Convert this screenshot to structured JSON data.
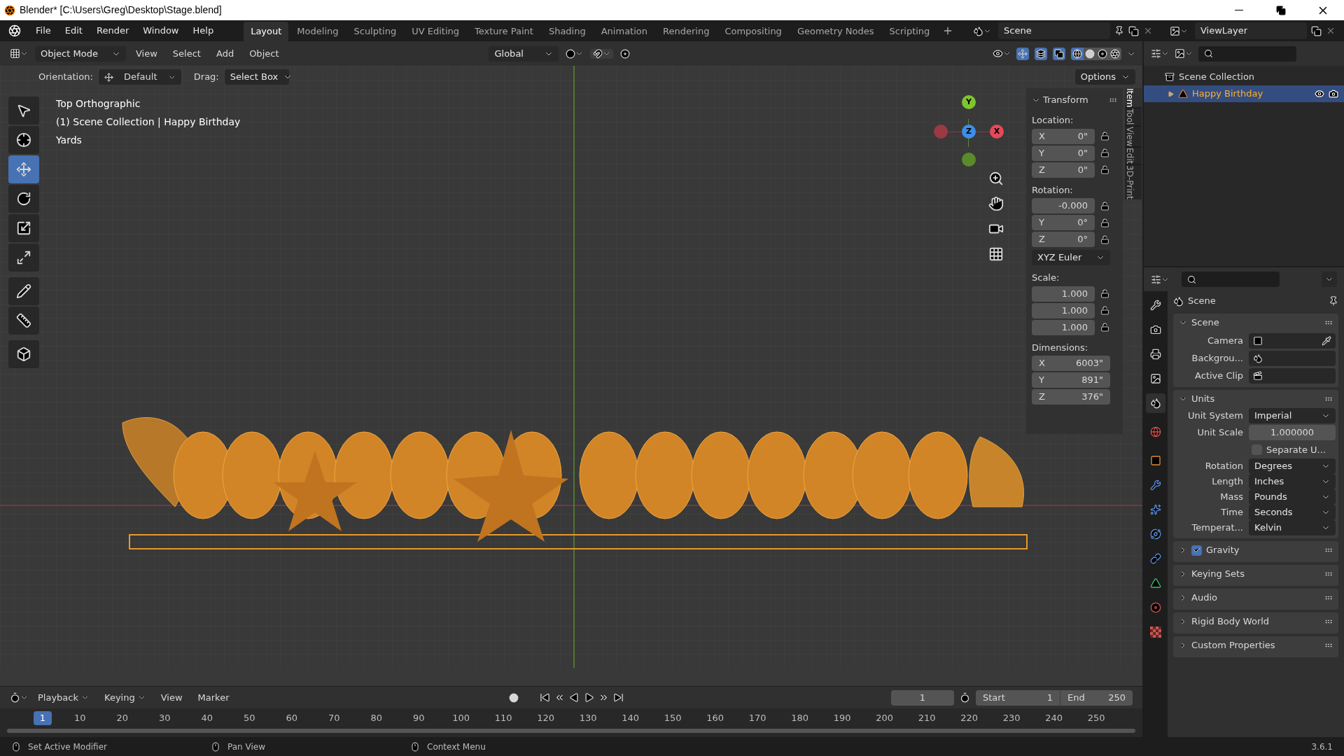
{
  "window": {
    "title": "Blender* [C:\\Users\\Greg\\Desktop\\Stage.blend]"
  },
  "menu": [
    "File",
    "Edit",
    "Render",
    "Window",
    "Help"
  ],
  "workspaces": [
    {
      "label": "Layout",
      "selected": true
    },
    {
      "label": "Modeling",
      "selected": false
    },
    {
      "label": "Sculpting",
      "selected": false
    },
    {
      "label": "UV Editing",
      "selected": false
    },
    {
      "label": "Texture Paint",
      "selected": false
    },
    {
      "label": "Shading",
      "selected": false
    },
    {
      "label": "Animation",
      "selected": false
    },
    {
      "label": "Rendering",
      "selected": false
    },
    {
      "label": "Compositing",
      "selected": false
    },
    {
      "label": "Geometry Nodes",
      "selected": false
    },
    {
      "label": "Scripting",
      "selected": false
    }
  ],
  "scene_selector": {
    "value": "Scene"
  },
  "view_layer": {
    "value": "ViewLayer"
  },
  "viewport_header": {
    "mode": "Object Mode",
    "menus": [
      "View",
      "Select",
      "Add",
      "Object"
    ],
    "transform_orientation": "Global"
  },
  "tool_settings": {
    "orientation_label": "Orientation:",
    "orientation": "Default",
    "drag_label": "Drag:",
    "drag": "Select Box",
    "options": "Options"
  },
  "toolbar": [
    {
      "kind": "select",
      "selected": false
    },
    {
      "kind": "cursor",
      "selected": false
    },
    {
      "kind": "move",
      "selected": true
    },
    {
      "kind": "rotate",
      "selected": false
    },
    {
      "kind": "scale",
      "selected": false
    },
    {
      "kind": "transform",
      "selected": false
    },
    {
      "kind": "annotate",
      "selected": false
    },
    {
      "kind": "measure",
      "selected": false
    },
    {
      "kind": "add-cube",
      "selected": false
    }
  ],
  "viewport_info": [
    "Top Orthographic",
    "(1) Scene Collection | Happy Birthday",
    "Yards"
  ],
  "gizmo": {
    "axes": [
      "Y",
      "Z",
      "X"
    ]
  },
  "sidebar_tabs": [
    {
      "label": "Item",
      "selected": true
    },
    {
      "label": "Tool",
      "selected": false
    },
    {
      "label": "View",
      "selected": false
    },
    {
      "label": "Edit",
      "selected": false
    },
    {
      "label": "3D-Print",
      "selected": false
    }
  ],
  "transform": {
    "title": "Transform",
    "groups": [
      {
        "kind": "vector_lock",
        "label": "Location:",
        "fields": [
          {
            "axis": "X",
            "value": "0\""
          },
          {
            "axis": "Y",
            "value": "0\""
          },
          {
            "axis": "Z",
            "value": "0\""
          }
        ]
      },
      {
        "kind": "vector_lock",
        "label": "Rotation:",
        "fields": [
          {
            "value": "-0.000"
          },
          {
            "axis": "Y",
            "value": "0°"
          },
          {
            "axis": "Z",
            "value": "0°"
          }
        ]
      },
      {
        "kind": "dropdown",
        "value": "XYZ Euler"
      },
      {
        "kind": "vector_lock",
        "label": "Scale:",
        "fields": [
          {
            "value": "1.000"
          },
          {
            "value": "1.000"
          },
          {
            "value": "1.000"
          }
        ]
      },
      {
        "kind": "vector",
        "label": "Dimensions:",
        "fields": [
          {
            "axis": "X",
            "value": "6003\""
          },
          {
            "axis": "Y",
            "value": "891\""
          },
          {
            "axis": "Z",
            "value": "376\""
          }
        ]
      }
    ]
  },
  "outliner": {
    "items": [
      {
        "label": "Scene Collection",
        "selected": false,
        "children": [
          {
            "label": "Happy Birthday",
            "selected": true,
            "expanded": false
          }
        ]
      }
    ]
  },
  "properties": {
    "tabs": [
      {
        "kind": "tool",
        "selected": false
      },
      {
        "kind": "render",
        "selected": false
      },
      {
        "kind": "output",
        "selected": false
      },
      {
        "kind": "view_layer",
        "selected": false
      },
      {
        "kind": "scene",
        "selected": true
      },
      {
        "kind": "world",
        "selected": false
      },
      {
        "kind": "object",
        "selected": false
      },
      {
        "kind": "modifiers",
        "selected": false
      },
      {
        "kind": "particles",
        "selected": false
      },
      {
        "kind": "physics",
        "selected": false
      },
      {
        "kind": "constraints",
        "selected": false
      },
      {
        "kind": "data",
        "selected": false
      },
      {
        "kind": "material",
        "selected": false
      },
      {
        "kind": "texture",
        "selected": false
      }
    ],
    "context": "Scene",
    "panels": [
      {
        "title": "Scene",
        "expanded": true,
        "rows": [
          {
            "kind": "id",
            "label": "Camera"
          },
          {
            "kind": "id",
            "label": "Backgrou..."
          },
          {
            "kind": "id",
            "label": "Active Clip"
          }
        ]
      },
      {
        "title": "Units",
        "expanded": true,
        "rows": [
          {
            "kind": "dropdown",
            "label": "Unit System",
            "value": "Imperial"
          },
          {
            "kind": "number",
            "label": "Unit Scale",
            "value": "1.000000"
          },
          {
            "kind": "checkbox",
            "label": "Separate U...",
            "checked": false
          },
          {
            "kind": "dropdown",
            "label": "Rotation",
            "value": "Degrees"
          },
          {
            "kind": "dropdown",
            "label": "Length",
            "value": "Inches"
          },
          {
            "kind": "dropdown",
            "label": "Mass",
            "value": "Pounds"
          },
          {
            "kind": "dropdown",
            "label": "Time",
            "value": "Seconds"
          },
          {
            "kind": "dropdown",
            "label": "Temperat...",
            "value": "Kelvin"
          }
        ]
      },
      {
        "title": "Gravity",
        "expanded": false,
        "checked": true
      },
      {
        "title": "Keying Sets",
        "expanded": false
      },
      {
        "title": "Audio",
        "expanded": false
      },
      {
        "title": "Rigid Body World",
        "expanded": false
      },
      {
        "title": "Custom Properties",
        "expanded": false
      }
    ]
  },
  "timeline": {
    "menus": [
      "Playback",
      "Keying",
      "View",
      "Marker"
    ],
    "current_frame": "1",
    "start_label": "Start",
    "start": "1",
    "end_label": "End",
    "end": "250",
    "playhead": "1",
    "ticks": [
      "10",
      "20",
      "30",
      "40",
      "50",
      "60",
      "70",
      "80",
      "90",
      "100",
      "110",
      "120",
      "130",
      "140",
      "150",
      "160",
      "170",
      "180",
      "190",
      "200",
      "210",
      "220",
      "230",
      "240",
      "250"
    ]
  },
  "status_bar": {
    "items": [
      "Set Active Modifier",
      "Pan View",
      "Context Menu"
    ],
    "version": "3.6.1"
  }
}
